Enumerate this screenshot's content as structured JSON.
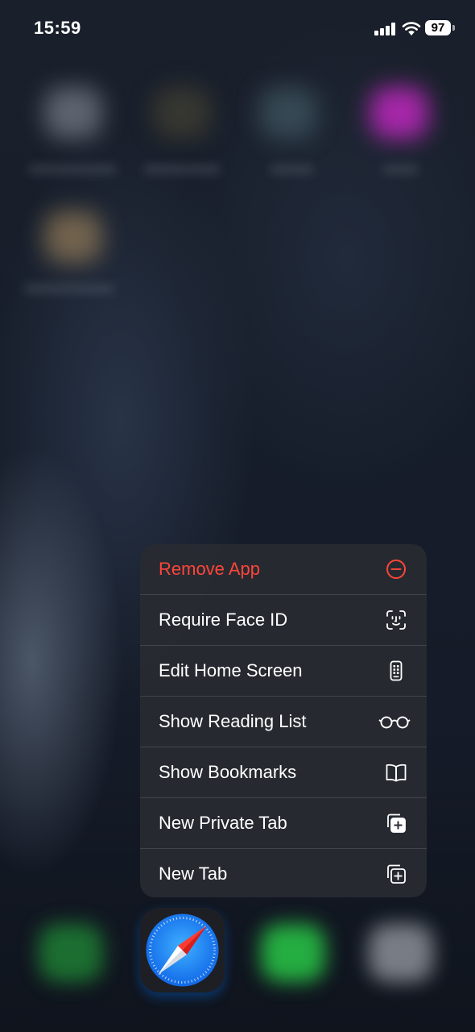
{
  "status_bar": {
    "time": "15:59",
    "battery_level": "97",
    "signal_icon": "cellular-signal-icon",
    "wifi_icon": "wifi-icon"
  },
  "context_menu": {
    "app": "Safari",
    "items": [
      {
        "label": "Remove App",
        "icon": "minus-circle-icon",
        "destructive": true,
        "color": "#ff453a"
      },
      {
        "label": "Require Face ID",
        "icon": "face-id-icon",
        "destructive": false
      },
      {
        "label": "Edit Home Screen",
        "icon": "phone-apps-icon",
        "destructive": false
      },
      {
        "label": "Show Reading List",
        "icon": "glasses-icon",
        "destructive": false
      },
      {
        "label": "Show Bookmarks",
        "icon": "book-icon",
        "destructive": false
      },
      {
        "label": "New Private Tab",
        "icon": "private-tab-plus-icon",
        "destructive": false
      },
      {
        "label": "New Tab",
        "icon": "tab-plus-icon",
        "destructive": false
      }
    ]
  },
  "dock": {
    "focused_app_icon": "safari-compass-icon",
    "apps": [
      "phone-icon",
      "safari-compass-icon",
      "messages-icon",
      "blurred-app-icon"
    ]
  },
  "colors": {
    "menu_background": "#2b2e34",
    "destructive": "#ff453a",
    "safari_blue": "#1f8bff"
  }
}
